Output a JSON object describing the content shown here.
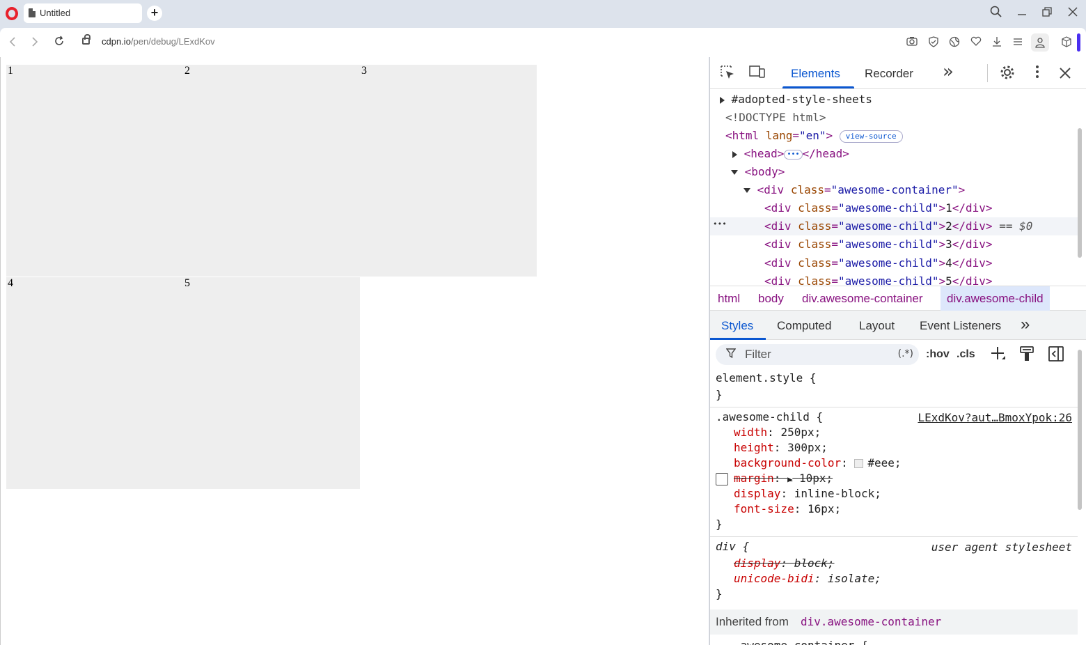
{
  "browser": {
    "tab_title": "Untitled",
    "new_tab": "+",
    "url_host": "cdpn.io",
    "url_path": "/pen/debug/LExdKov"
  },
  "page": {
    "children": [
      "1",
      "2",
      "3",
      "4",
      "5"
    ]
  },
  "devtools": {
    "tabs": [
      "Elements",
      "Recorder"
    ],
    "more_tabs": "»",
    "dom": {
      "adopted": "#adopted-style-sheets",
      "doctype": "<!DOCTYPE html>",
      "html_open": "<html",
      "html_attr": "lang",
      "html_val": "\"en\"",
      "view_source": "view-source",
      "head": "<head>",
      "head_close": "</head>",
      "body": "<body>",
      "container_tag": "<div",
      "class_attr": "class",
      "container_class": "\"awesome-container\"",
      "child_class": "\"awesome-child\"",
      "div_close": "</div>",
      "selected_marker": "== $0",
      "gutter_dots": "•••",
      "ellipsis": "•••",
      "children": [
        "1",
        "2",
        "3",
        "4",
        "5"
      ]
    },
    "breadcrumbs": [
      "html",
      "body",
      "div.awesome-container",
      "div.awesome-child"
    ],
    "sub_tabs": [
      "Styles",
      "Computed",
      "Layout",
      "Event Listeners"
    ],
    "filter": {
      "placeholder": "Filter",
      "regex": "(.*)",
      "hov": ":hov",
      "cls": ".cls"
    },
    "styles": {
      "element_style": "element.style {",
      "close_brace": "}",
      "rule1_selector": ".awesome-child {",
      "rule1_source": "LExdKov?aut…BmoxYpok:26",
      "rule1_props": [
        {
          "name": "width",
          "value": "250px;"
        },
        {
          "name": "height",
          "value": "300px;"
        },
        {
          "name": "background-color",
          "value": "#eee;"
        },
        {
          "name": "margin",
          "value": "10px;"
        },
        {
          "name": "display",
          "value": "inline-block;"
        },
        {
          "name": "font-size",
          "value": "16px;"
        }
      ],
      "rule2_selector": "div {",
      "rule2_source": "user agent stylesheet",
      "rule2_props": [
        {
          "name": "display",
          "value": "block;"
        },
        {
          "name": "unicode-bidi",
          "value": "isolate;"
        }
      ],
      "inherited_label": "Inherited from",
      "inherited_from": "div.awesome-container",
      "next_rule": ".awesome-container {"
    }
  },
  "colors": {
    "accent": "#0b57d0",
    "tag": "#881280",
    "attr_name": "#994500",
    "attr_value": "#1a1aa6",
    "prop": "#c80000",
    "child_bg": "#eeeeee"
  }
}
